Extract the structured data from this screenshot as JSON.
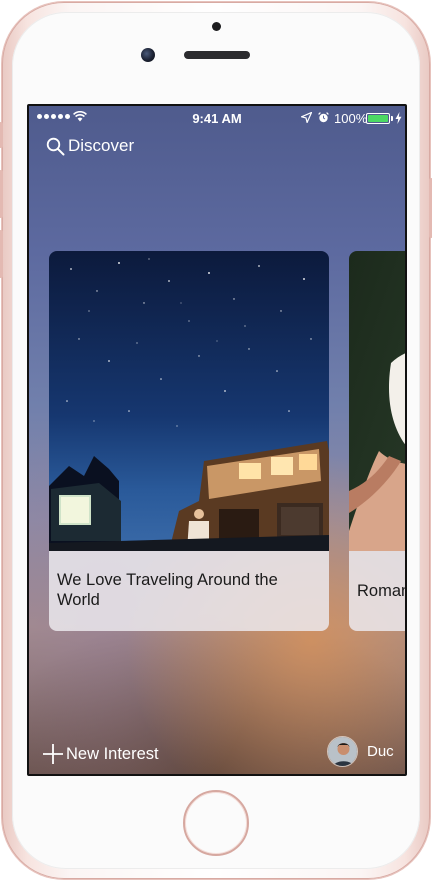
{
  "status_bar": {
    "time": "9:41 AM",
    "battery": "100%",
    "signal_icon": "signal-dots-icon",
    "wifi_icon": "wifi-icon",
    "location_icon": "location-arrow-icon",
    "alarm_icon": "alarm-clock-icon",
    "battery_level": 1.0,
    "battery_color": "#4cd964"
  },
  "header": {
    "title": "Discover",
    "icon": "search-icon"
  },
  "cards": [
    {
      "caption": "We Love Traveling Around the World",
      "image": "night-sky-camper-van-photo"
    },
    {
      "caption": "Roman",
      "image": "person-portrait-photo"
    }
  ],
  "footer": {
    "new_interest_label": "New Interest",
    "new_interest_icon": "plus-icon",
    "user_name": "Duc"
  },
  "colors": {
    "text": "#ffffff",
    "caption_text": "#1b1b1b",
    "device_rose_gold": "#e3b9b2"
  }
}
